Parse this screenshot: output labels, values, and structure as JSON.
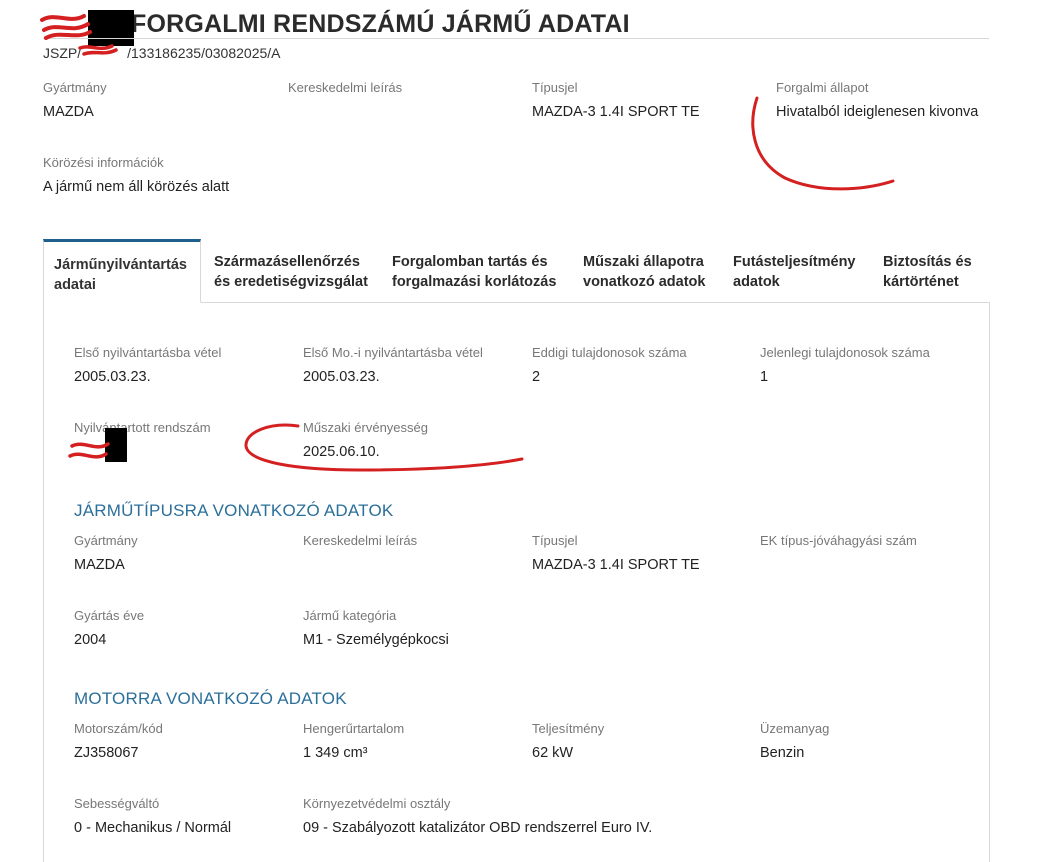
{
  "header": {
    "title": "FORGALMI RENDSZÁMÚ JÁRMŰ ADATAI",
    "ref": "/133186235/03082025/A",
    "ref_prefix": "JSZP/"
  },
  "summary": [
    {
      "label": "Gyártmány",
      "value": "MAZDA"
    },
    {
      "label": "Kereskedelmi leírás",
      "value": ""
    },
    {
      "label": "Típusjel",
      "value": "MAZDA-3 1.4I SPORT TE"
    },
    {
      "label": "Forgalmi állapot",
      "value": "Hivatalból ideiglenesen kivonva"
    },
    {
      "label": "Körözési információk",
      "value": "A jármű nem áll körözés alatt"
    }
  ],
  "tabs": [
    {
      "label": "Járműnyilvántartás adatai",
      "active": true
    },
    {
      "label": "Származásellenőrzés és eredetiségvizsgálat",
      "active": false
    },
    {
      "label": "Forgalomban tartás és forgalmazási korlátozás",
      "active": false
    },
    {
      "label": "Műszaki állapotra vonatkozó adatok",
      "active": false
    },
    {
      "label": "Futásteljesítmény adatok",
      "active": false
    },
    {
      "label": "Biztosítás és kártörténet",
      "active": false
    }
  ],
  "registry": [
    {
      "label": "Első nyilvántartásba vétel",
      "value": "2005.03.23."
    },
    {
      "label": "Első Mo.-i nyilvántartásba vétel",
      "value": "2005.03.23."
    },
    {
      "label": "Eddigi tulajdonosok száma",
      "value": "2"
    },
    {
      "label": "Jelenlegi tulajdonosok száma",
      "value": "1"
    },
    {
      "label": "Nyilvántartott rendszám",
      "value": ""
    },
    {
      "label": "Műszaki érvényesség",
      "value": "2025.06.10."
    }
  ],
  "vehicle_type": {
    "title": "JÁRMŰTÍPUSRA VONATKOZÓ ADATOK",
    "fields": [
      {
        "label": "Gyártmány",
        "value": "MAZDA"
      },
      {
        "label": "Kereskedelmi leírás",
        "value": ""
      },
      {
        "label": "Típusjel",
        "value": "MAZDA-3 1.4I SPORT TE"
      },
      {
        "label": "EK típus-jóváhagyási szám",
        "value": ""
      },
      {
        "label": "Gyártás éve",
        "value": "2004"
      },
      {
        "label": "Jármű kategória",
        "value": "M1 - Személygépkocsi"
      }
    ]
  },
  "engine": {
    "title": "MOTORRA VONATKOZÓ ADATOK",
    "fields": [
      {
        "label": "Motorszám/kód",
        "value": "ZJ358067"
      },
      {
        "label": "Hengerűrtartalom",
        "value": "1 349 cm³"
      },
      {
        "label": "Teljesítmény",
        "value": "62 kW"
      },
      {
        "label": "Üzemanyag",
        "value": "Benzin"
      },
      {
        "label": "Sebességváltó",
        "value": "0 - Mechanikus / Normál"
      },
      {
        "label": "Környezetvédelmi osztály",
        "value": "09 - Szabályozott katalizátor OBD rendszerrel Euro IV."
      }
    ]
  },
  "colors": {
    "accent": "#2b6f9b",
    "annotation": "#d42020"
  }
}
